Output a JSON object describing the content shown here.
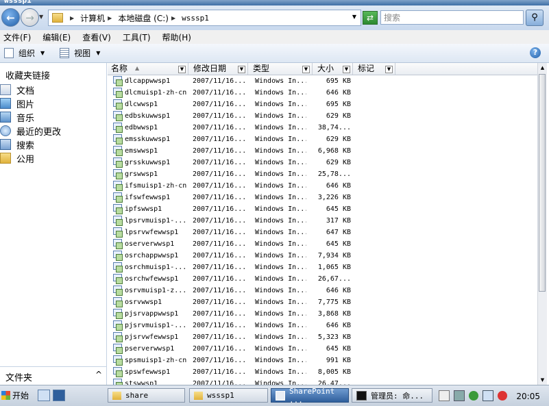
{
  "window": {
    "title": "wsssp1"
  },
  "address": {
    "crumbs": [
      "计算机",
      "本地磁盘 (C:)",
      "wsssp1"
    ],
    "search_placeholder": "搜索"
  },
  "menu": [
    "文件(F)",
    "编辑(E)",
    "查看(V)",
    "工具(T)",
    "帮助(H)"
  ],
  "toolbar": {
    "organize": "组织",
    "views": "视图"
  },
  "sidebar": {
    "title": "收藏夹链接",
    "items": [
      {
        "label": "文档",
        "icon": "documents-icon"
      },
      {
        "label": "图片",
        "icon": "pictures-icon"
      },
      {
        "label": "音乐",
        "icon": "music-icon"
      },
      {
        "label": "最近的更改",
        "icon": "recent-changes-icon"
      },
      {
        "label": "搜索",
        "icon": "search-folder-icon"
      },
      {
        "label": "公用",
        "icon": "public-folder-icon"
      }
    ],
    "folders_label": "文件夹",
    "folders_chevron": "^"
  },
  "columns": {
    "name": "名称",
    "date": "修改日期",
    "type": "类型",
    "size": "大小",
    "tags": "标记"
  },
  "files": [
    {
      "name": "dlcappwwsp1",
      "date": "2007/11/16...",
      "type": "Windows In...",
      "size": "695 KB"
    },
    {
      "name": "dlcmuisp1-zh-cn",
      "date": "2007/11/16...",
      "type": "Windows In...",
      "size": "646 KB"
    },
    {
      "name": "dlcwwsp1",
      "date": "2007/11/16...",
      "type": "Windows In...",
      "size": "695 KB"
    },
    {
      "name": "edbskuwwsp1",
      "date": "2007/11/16...",
      "type": "Windows In...",
      "size": "629 KB"
    },
    {
      "name": "edbwwsp1",
      "date": "2007/11/16...",
      "type": "Windows In...",
      "size": "38,74..."
    },
    {
      "name": "emsskuwwsp1",
      "date": "2007/11/16...",
      "type": "Windows In...",
      "size": "629 KB"
    },
    {
      "name": "emswwsp1",
      "date": "2007/11/16...",
      "type": "Windows In...",
      "size": "6,968 KB"
    },
    {
      "name": "grsskuwwsp1",
      "date": "2007/11/16...",
      "type": "Windows In...",
      "size": "629 KB"
    },
    {
      "name": "grswwsp1",
      "date": "2007/11/16...",
      "type": "Windows In...",
      "size": "25,78..."
    },
    {
      "name": "ifsmuisp1-zh-cn",
      "date": "2007/11/16...",
      "type": "Windows In...",
      "size": "646 KB"
    },
    {
      "name": "ifswfewwsp1",
      "date": "2007/11/16...",
      "type": "Windows In...",
      "size": "3,226 KB"
    },
    {
      "name": "ipfswwsp1",
      "date": "2007/11/16...",
      "type": "Windows In...",
      "size": "645 KB"
    },
    {
      "name": "lpsrvmuisp1-...",
      "date": "2007/11/16...",
      "type": "Windows In...",
      "size": "317 KB"
    },
    {
      "name": "lpsrvwfewwsp1",
      "date": "2007/11/16...",
      "type": "Windows In...",
      "size": "647 KB"
    },
    {
      "name": "oserverwwsp1",
      "date": "2007/11/16...",
      "type": "Windows In...",
      "size": "645 KB"
    },
    {
      "name": "osrchappwwsp1",
      "date": "2007/11/16...",
      "type": "Windows In...",
      "size": "7,934 KB"
    },
    {
      "name": "osrchmuisp1-...",
      "date": "2007/11/16...",
      "type": "Windows In...",
      "size": "1,065 KB"
    },
    {
      "name": "osrchwfewwsp1",
      "date": "2007/11/16...",
      "type": "Windows In...",
      "size": "26,67..."
    },
    {
      "name": "osrvmuisp1-z...",
      "date": "2007/11/16...",
      "type": "Windows In...",
      "size": "646 KB"
    },
    {
      "name": "osrvwwsp1",
      "date": "2007/11/16...",
      "type": "Windows In...",
      "size": "7,775 KB"
    },
    {
      "name": "pjsrvappwwsp1",
      "date": "2007/11/16...",
      "type": "Windows In...",
      "size": "3,868 KB"
    },
    {
      "name": "pjsrvmuisp1-...",
      "date": "2007/11/16...",
      "type": "Windows In...",
      "size": "646 KB"
    },
    {
      "name": "pjsrvwfewwsp1",
      "date": "2007/11/16...",
      "type": "Windows In...",
      "size": "5,323 KB"
    },
    {
      "name": "pserverwwsp1",
      "date": "2007/11/16...",
      "type": "Windows In...",
      "size": "645 KB"
    },
    {
      "name": "spsmuisp1-zh-cn",
      "date": "2007/11/16...",
      "type": "Windows In...",
      "size": "991 KB"
    },
    {
      "name": "spswfewwsp1",
      "date": "2007/11/16...",
      "type": "Windows In...",
      "size": "8,005 KB"
    },
    {
      "name": "stswwsp1",
      "date": "2007/11/16...",
      "type": "Windows In...",
      "size": "26,47..."
    }
  ],
  "taskbar": {
    "start": "开始",
    "tasks": [
      {
        "label": "share",
        "active": false
      },
      {
        "label": "wsssp1",
        "active": false
      },
      {
        "label": "SharePoint ...",
        "active": true
      },
      {
        "label": "管理员: 命...",
        "active": false
      }
    ],
    "clock": "20:05"
  }
}
